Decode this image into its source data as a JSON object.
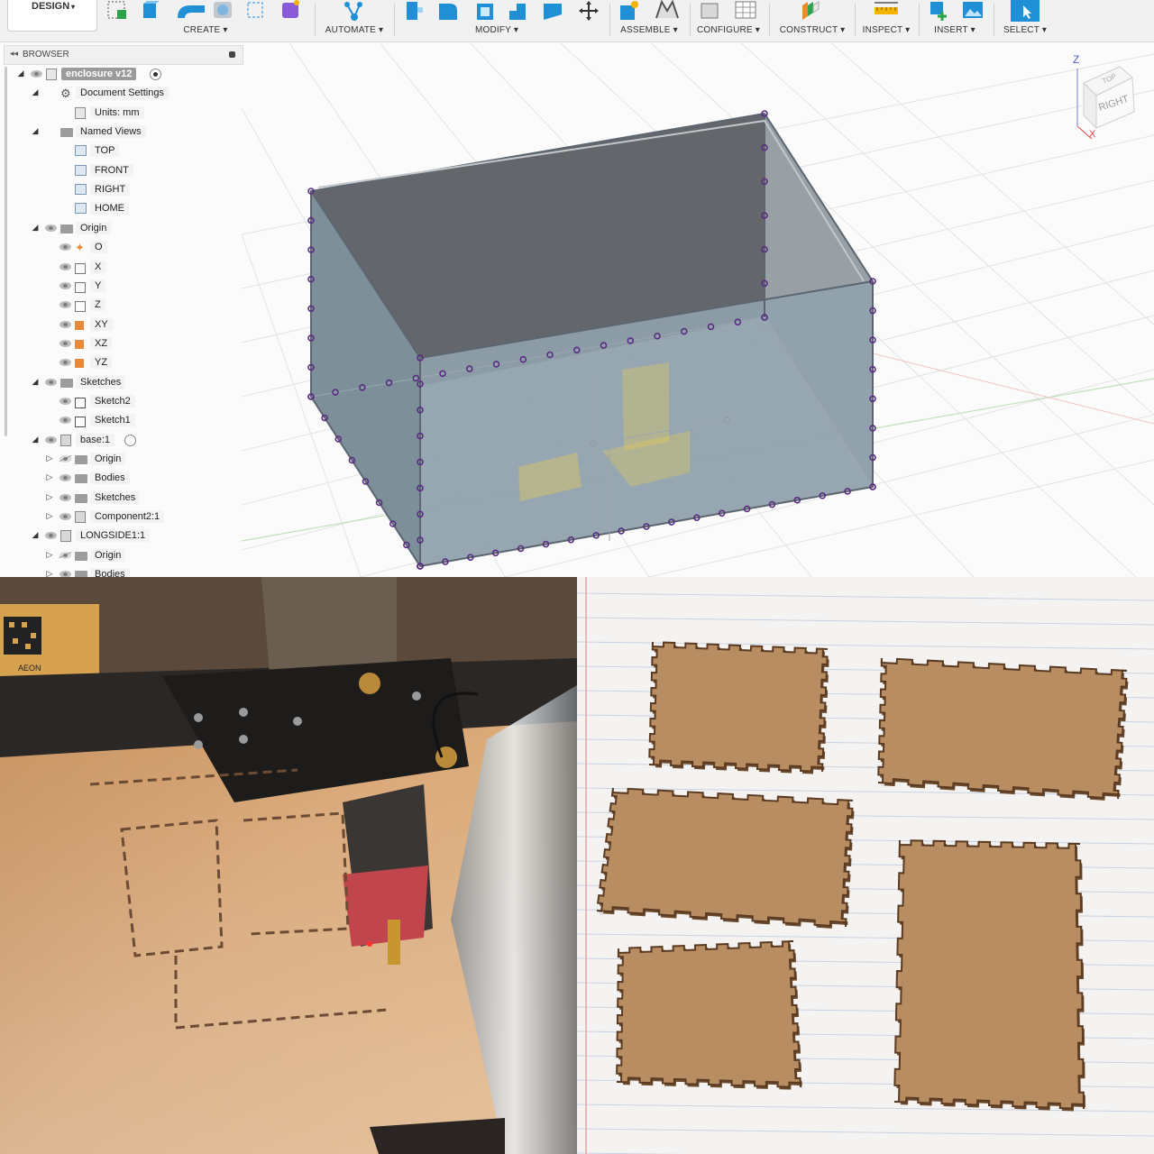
{
  "toolbar": {
    "workspace": "DESIGN",
    "groups": [
      {
        "label": "CREATE ▾"
      },
      {
        "label": "AUTOMATE ▾"
      },
      {
        "label": "MODIFY ▾"
      },
      {
        "label": "ASSEMBLE ▾"
      },
      {
        "label": "CONFIGURE ▾"
      },
      {
        "label": "CONSTRUCT ▾"
      },
      {
        "label": "INSPECT ▾"
      },
      {
        "label": "INSERT ▾"
      },
      {
        "label": "SELECT ▾"
      }
    ]
  },
  "browser": {
    "title": "BROWSER",
    "items": [
      {
        "label": "enclosure v12",
        "icon": "document-icon"
      },
      {
        "label": "Document Settings",
        "icon": "gear-icon"
      },
      {
        "label": "Units: mm",
        "icon": "units-icon"
      },
      {
        "label": "Named Views",
        "icon": "folder-icon"
      },
      {
        "label": "TOP",
        "icon": "named-view-icon"
      },
      {
        "label": "FRONT",
        "icon": "named-view-icon"
      },
      {
        "label": "RIGHT",
        "icon": "named-view-icon"
      },
      {
        "label": "HOME",
        "icon": "named-view-icon"
      },
      {
        "label": "Origin",
        "icon": "folder-icon"
      },
      {
        "label": "O",
        "icon": "origin-point-icon"
      },
      {
        "label": "X",
        "icon": "axis-icon"
      },
      {
        "label": "Y",
        "icon": "axis-icon"
      },
      {
        "label": "Z",
        "icon": "axis-icon"
      },
      {
        "label": "XY",
        "icon": "plane-icon"
      },
      {
        "label": "XZ",
        "icon": "plane-icon"
      },
      {
        "label": "YZ",
        "icon": "plane-icon"
      },
      {
        "label": "Sketches",
        "icon": "folder-icon"
      },
      {
        "label": "Sketch2",
        "icon": "sketch-icon"
      },
      {
        "label": "Sketch1",
        "icon": "sketch-icon"
      },
      {
        "label": "base:1",
        "icon": "component-icon"
      },
      {
        "label": "Origin",
        "icon": "folder-icon"
      },
      {
        "label": "Bodies",
        "icon": "folder-icon"
      },
      {
        "label": "Sketches",
        "icon": "folder-icon"
      },
      {
        "label": "Component2:1",
        "icon": "component-icon"
      },
      {
        "label": "LONGSIDE1:1",
        "icon": "component-icon"
      },
      {
        "label": "Origin",
        "icon": "folder-icon"
      },
      {
        "label": "Bodies",
        "icon": "folder-icon"
      }
    ]
  },
  "viewcube": {
    "face": "RIGHT",
    "top_face": "TOP",
    "axis_z": "Z",
    "axis_x": "X"
  },
  "photos": {
    "laser_label": "AEON",
    "laser_caption": "",
    "parts_caption": ""
  },
  "colors": {
    "accent": "#0696d7",
    "body": "#8c9aa3",
    "constraint": "#5a2d82"
  }
}
